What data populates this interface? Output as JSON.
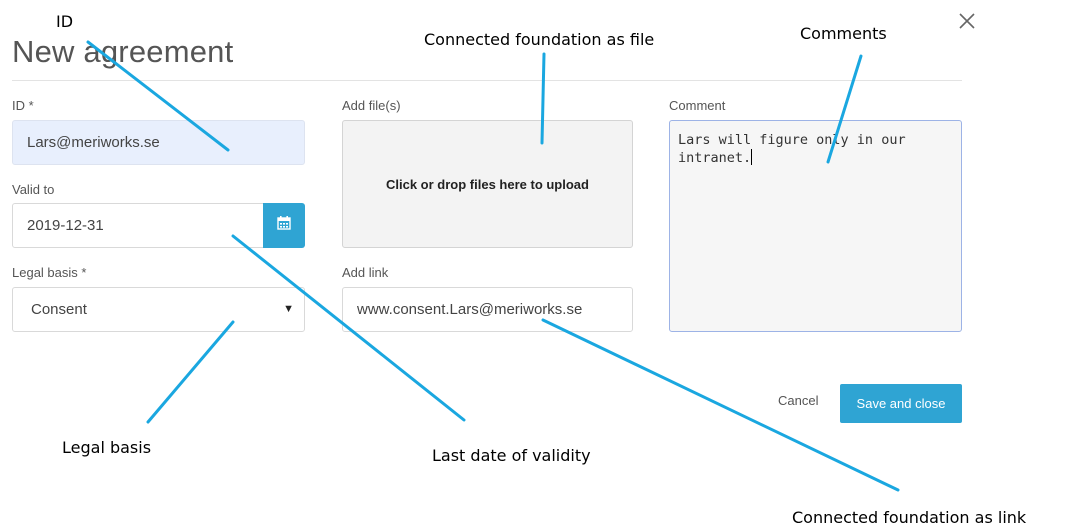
{
  "dialog": {
    "title": "New agreement",
    "close_icon": "close-icon"
  },
  "form": {
    "id_label": "ID *",
    "id_value": "Lars@meriworks.se",
    "valid_to_label": "Valid to",
    "valid_to_value": "2019-12-31",
    "calendar_icon": "calendar-icon",
    "legal_basis_label": "Legal basis *",
    "legal_basis_value": "Consent",
    "add_files_label": "Add file(s)",
    "dropzone_text": "Click or drop files here to upload",
    "add_link_label": "Add link",
    "link_value": "www.consent.Lars@meriworks.se",
    "comment_label": "Comment",
    "comment_value": "Lars will figure only in our intranet."
  },
  "actions": {
    "cancel_label": "Cancel",
    "save_label": "Save and close"
  },
  "annotations": {
    "id": "ID",
    "file": "Connected foundation as file",
    "comments": "Comments",
    "legal_basis": "Legal basis",
    "validity": "Last date of validity",
    "link": "Connected foundation as link"
  },
  "colors": {
    "accent": "#2fa4d3",
    "annotation_line": "#1aa7e0",
    "id_field_bg": "#e8effd"
  }
}
